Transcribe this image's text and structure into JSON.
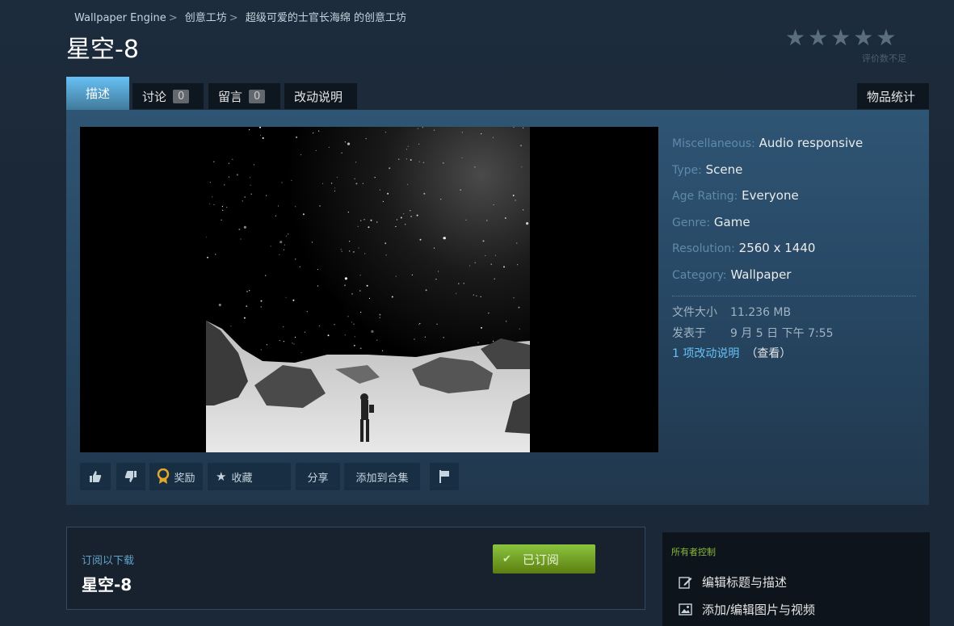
{
  "breadcrumb": [
    {
      "label": "Wallpaper Engine"
    },
    {
      "label": "创意工坊"
    },
    {
      "label": "超级可爱的士官长海绵 的创意工坊"
    }
  ],
  "item": {
    "title": "星空-8",
    "stars": "★★★★★",
    "rating_note": "评价数不足"
  },
  "tabs": [
    {
      "label": "描述"
    },
    {
      "label": "讨论",
      "count": "0"
    },
    {
      "label": "留言",
      "count": "0"
    },
    {
      "label": "改动说明"
    }
  ],
  "stats_tab": "物品统计",
  "details": [
    {
      "label": "Miscellaneous:",
      "value": "Audio responsive"
    },
    {
      "label": "Type:",
      "value": "Scene"
    },
    {
      "label": "Age Rating:",
      "value": "Everyone"
    },
    {
      "label": "Genre:",
      "value": "Game"
    },
    {
      "label": "Resolution:",
      "value": "2560 x 1440"
    },
    {
      "label": "Category:",
      "value": "Wallpaper"
    }
  ],
  "meta": {
    "size_label": "文件大小",
    "size_value": "11.236 MB",
    "posted_label": "发表于",
    "posted_value": "9 月 5 日 下午 7:55",
    "changes_link": "1 项改动说明",
    "changes_view": "（查看）"
  },
  "actions": {
    "award": "奖励",
    "favorite": "收藏",
    "share": "分享",
    "add_collection": "添加到合集"
  },
  "subscribe": {
    "label": "订阅以下载",
    "title": "星空-8",
    "button": "已订阅"
  },
  "owner": {
    "heading": "所有者控制",
    "items": [
      {
        "label": "编辑标题与描述",
        "icon": "edit-icon"
      },
      {
        "label": "添加/编辑图片与视频",
        "icon": "image-icon"
      }
    ]
  },
  "colors": {
    "accent": "#67c1f5",
    "subscribed_green": "#8bc53f",
    "owner_heading": "#8bb83a",
    "background": "#1b2838"
  }
}
